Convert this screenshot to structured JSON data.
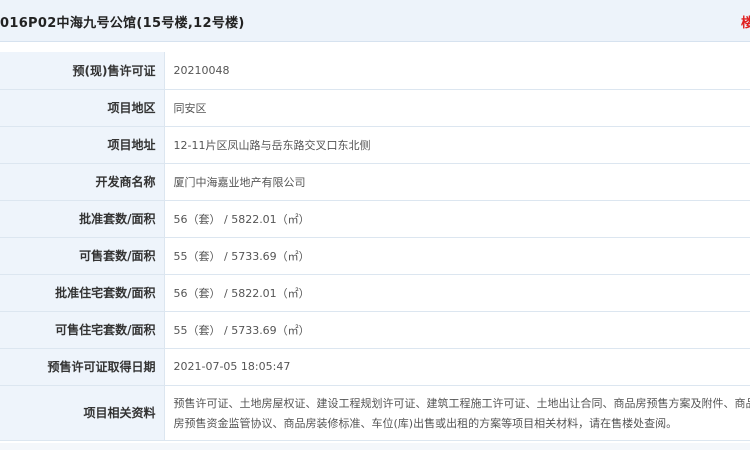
{
  "header": {
    "title": "016P02中海九号公馆(15号楼,12号楼)",
    "link_text": "楼"
  },
  "rows": [
    {
      "label": "预(现)售许可证",
      "value": "20210048"
    },
    {
      "label": "项目地区",
      "value": "同安区"
    },
    {
      "label": "项目地址",
      "value": "12-11片区凤山路与岳东路交叉口东北侧"
    },
    {
      "label": "开发商名称",
      "value": "厦门中海嘉业地产有限公司"
    },
    {
      "label": "批准套数/面积",
      "value": "56（套） / 5822.01（㎡）"
    },
    {
      "label": "可售套数/面积",
      "value": "55（套） / 5733.69（㎡）"
    },
    {
      "label": "批准住宅套数/面积",
      "value": "56（套） / 5822.01（㎡）"
    },
    {
      "label": "可售住宅套数/面积",
      "value": "55（套） / 5733.69（㎡）"
    },
    {
      "label": "预售许可证取得日期",
      "value": "2021-07-05 18:05:47"
    },
    {
      "label": "项目相关资料",
      "value": "预售许可证、土地房屋权证、建设工程规划许可证、建筑工程施工许可证、土地出让合同、商品房预售方案及附件、商品房预售资金监管协议、商品房装修标准、车位(库)出售或出租的方案等项目相关材料，请在售楼处查阅。"
    }
  ]
}
